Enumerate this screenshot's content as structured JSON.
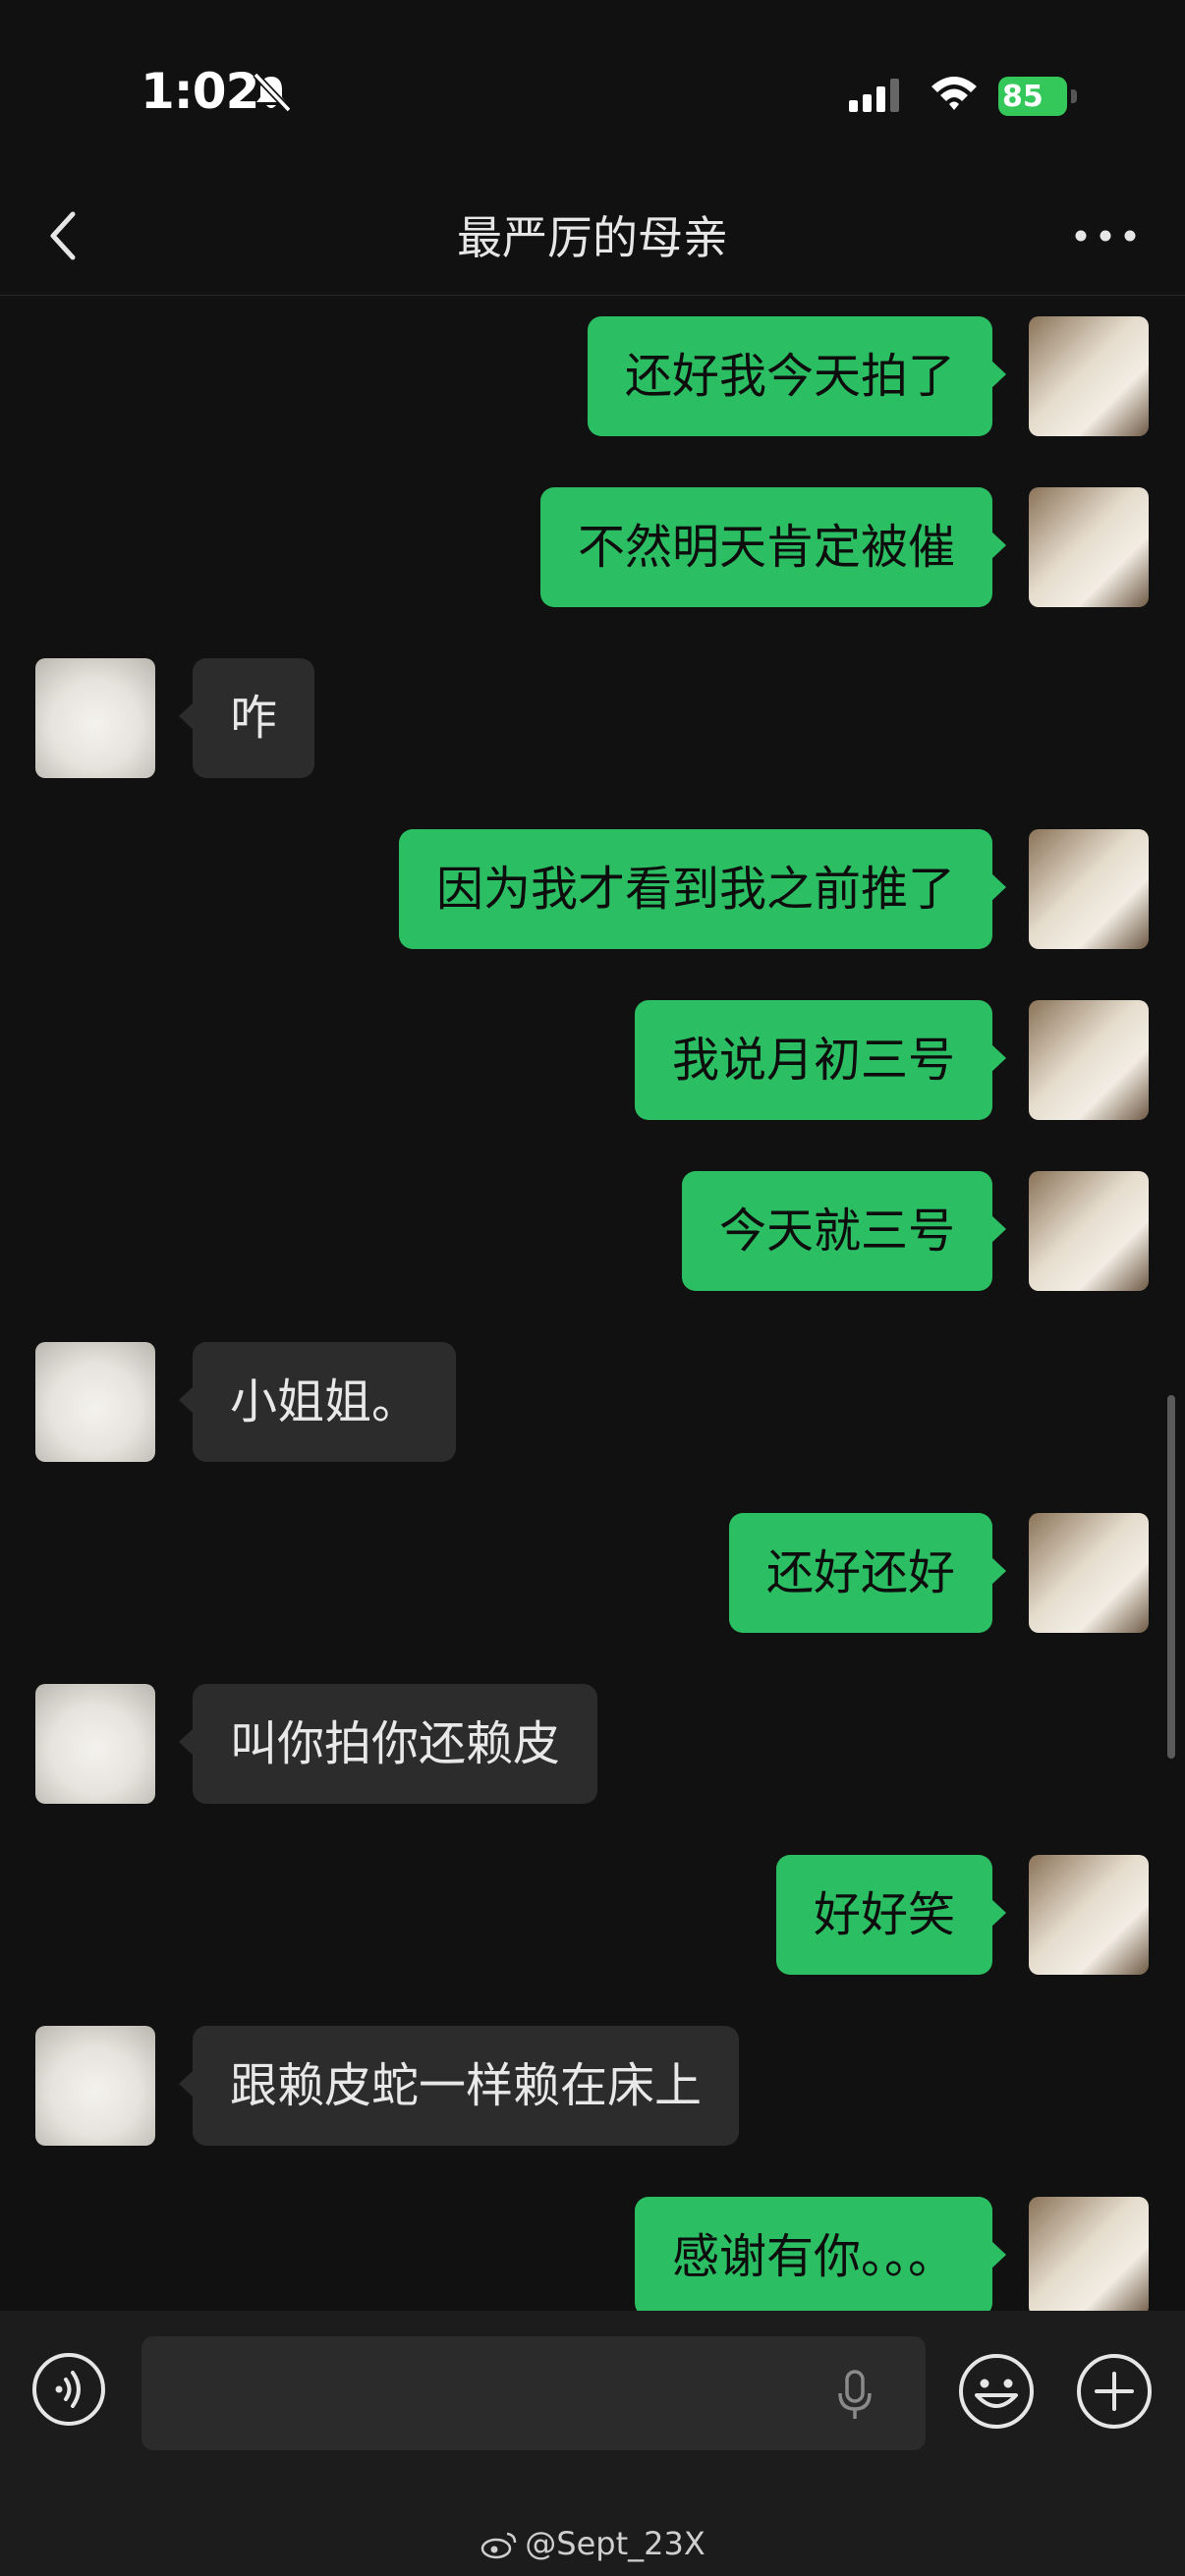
{
  "status_bar": {
    "time": "1:02",
    "battery": "85",
    "icons": [
      "bell-slash-icon",
      "cellular-signal-icon",
      "wifi-icon",
      "battery-charging-icon"
    ]
  },
  "nav": {
    "title": "最严厉的母亲",
    "back_icon": "chevron-left-icon",
    "more_icon": "more-dots-icon"
  },
  "messages": [
    {
      "sender": "me",
      "text": "还好我今天拍了"
    },
    {
      "sender": "me",
      "text": "不然明天肯定被催"
    },
    {
      "sender": "her",
      "text": "咋"
    },
    {
      "sender": "me",
      "text": "因为我才看到我之前推了"
    },
    {
      "sender": "me",
      "text": "我说月初三号"
    },
    {
      "sender": "me",
      "text": "今天就三号"
    },
    {
      "sender": "her",
      "text": "小姐姐。"
    },
    {
      "sender": "me",
      "text": "还好还好"
    },
    {
      "sender": "her",
      "text": "叫你拍你还赖皮"
    },
    {
      "sender": "me",
      "text": "好好笑"
    },
    {
      "sender": "her",
      "text": "跟赖皮蛇一样赖在床上"
    },
    {
      "sender": "me",
      "text": "感谢有你。。。"
    }
  ],
  "colors": {
    "background": "#111111",
    "my_bubble": "#2cbe63",
    "her_bubble": "#2c2c2c",
    "input_bar": "#1c1c1c"
  },
  "input_bar": {
    "icons": [
      "voice-icon",
      "microphone-icon",
      "emoji-icon",
      "plus-icon"
    ]
  },
  "watermark": "@Sept_23X"
}
